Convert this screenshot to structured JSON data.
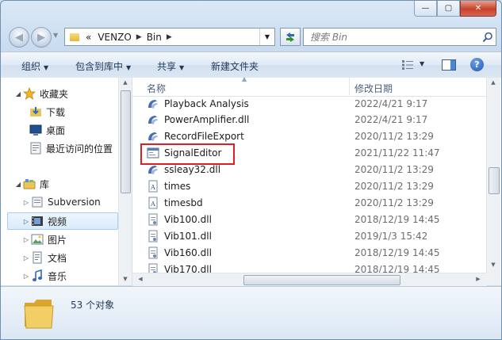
{
  "window": {
    "minimize_glyph": "—",
    "maximize_glyph": "▢",
    "close_glyph": "✕"
  },
  "address": {
    "overflow": "«",
    "crumbs": [
      "VENZO",
      "Bin"
    ]
  },
  "search": {
    "placeholder": "搜索 Bin"
  },
  "toolbar": {
    "organize": "组织",
    "include_in_library": "包含到库中",
    "share": "共享",
    "new_folder": "新建文件夹"
  },
  "sidebar": {
    "favorites": {
      "label": "收藏夹",
      "items": [
        "下载",
        "桌面",
        "最近访问的位置"
      ]
    },
    "libraries": {
      "label": "库",
      "items": [
        "Subversion",
        "视频",
        "图片",
        "文档",
        "音乐"
      ],
      "selected": "视频"
    }
  },
  "columns": {
    "name": "名称",
    "date_modified": "修改日期"
  },
  "files": [
    {
      "name": "Playback Analysis",
      "date": "2022/4/21 9:17",
      "icon": "app-icon"
    },
    {
      "name": "PowerAmplifier.dll",
      "date": "2022/4/21 9:17",
      "icon": "app-icon"
    },
    {
      "name": "RecordFileExport",
      "date": "2020/11/2 13:29",
      "icon": "app-icon"
    },
    {
      "name": "SignalEditor",
      "date": "2021/11/22 11:47",
      "icon": "window-app-icon"
    },
    {
      "name": "ssleay32.dll",
      "date": "2020/11/2 13:29",
      "icon": "app-icon"
    },
    {
      "name": "times",
      "date": "2020/11/2 13:29",
      "icon": "font-file-icon"
    },
    {
      "name": "timesbd",
      "date": "2020/11/2 13:29",
      "icon": "font-file-icon"
    },
    {
      "name": "Vib100.dll",
      "date": "2018/12/19 14:45",
      "icon": "dll-file-icon"
    },
    {
      "name": "Vib101.dll",
      "date": "2019/1/3 15:42",
      "icon": "dll-file-icon"
    },
    {
      "name": "Vib160.dll",
      "date": "2018/12/19 14:45",
      "icon": "dll-file-icon"
    },
    {
      "name": "Vib170.dll",
      "date": "2018/12/19 14:45",
      "icon": "dll-file-icon"
    }
  ],
  "status": {
    "item_count": "53 个对象"
  },
  "colors": {
    "highlight_box": "#e02020",
    "selected_nav_bg": "#d9ebfb"
  }
}
